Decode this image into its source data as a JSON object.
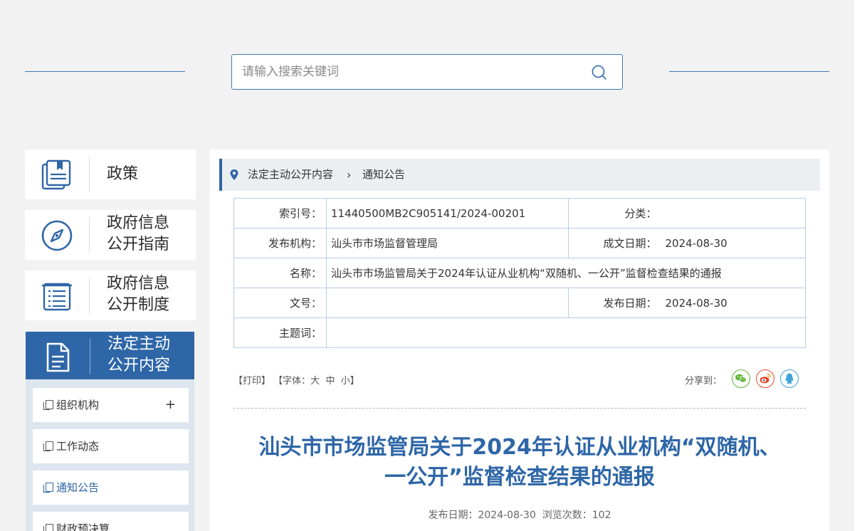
{
  "search": {
    "placeholder": "请输入搜索关键词"
  },
  "sidebar": {
    "cards": [
      {
        "label": "政策",
        "icon": "policy-book-icon"
      },
      {
        "label": "政府信息\n公开指南",
        "icon": "compass-icon"
      },
      {
        "label": "政府信息\n公开制度",
        "icon": "list-document-icon"
      },
      {
        "label": "法定主动\n公开内容",
        "icon": "document-icon"
      }
    ],
    "submenu": [
      {
        "label": "组织机构",
        "expand": "+"
      },
      {
        "label": "工作动态"
      },
      {
        "label": "通知公告"
      },
      {
        "label": "财政预决算"
      }
    ]
  },
  "breadcrumb": {
    "level1": "法定主动公开内容",
    "sep": "›",
    "level2": "通知公告"
  },
  "meta": {
    "index_label": "索引号：",
    "index_value": "11440500MB2C905141/2024-00201",
    "category_label": "分类：",
    "category_value": "",
    "org_label": "发布机构：",
    "org_value": "汕头市市场监督管理局",
    "written_label": "成文日期：",
    "written_value": "2024-08-30",
    "name_label": "名称：",
    "name_value": "汕头市市场监管局关于2024年认证从业机构“双随机、一公开”监督检查结果的通报",
    "docno_label": "文号：",
    "docno_value": "",
    "pubdate_label": "发布日期：",
    "pubdate_value": "2024-08-30",
    "keywords_label": "主题词：",
    "keywords_value": ""
  },
  "tools": {
    "print": "【打印】",
    "font_prefix": "【字体：",
    "font_large": "大",
    "font_medium": "中",
    "font_small": "小",
    "font_suffix": "】"
  },
  "share": {
    "label": "分享到：",
    "wechat_color": "#5fb336",
    "weibo_color": "#e6452e",
    "qq_color": "#3fa4d8"
  },
  "article": {
    "title": "汕头市市场监管局关于2024年认证从业机构“双随机、\n一公开”监督检查结果的通报",
    "pub_label": "发布日期：2024-08-30",
    "views_label": "浏览次数：102"
  },
  "colors": {
    "brand": "#2e66a7",
    "border": "#b9cde3"
  }
}
